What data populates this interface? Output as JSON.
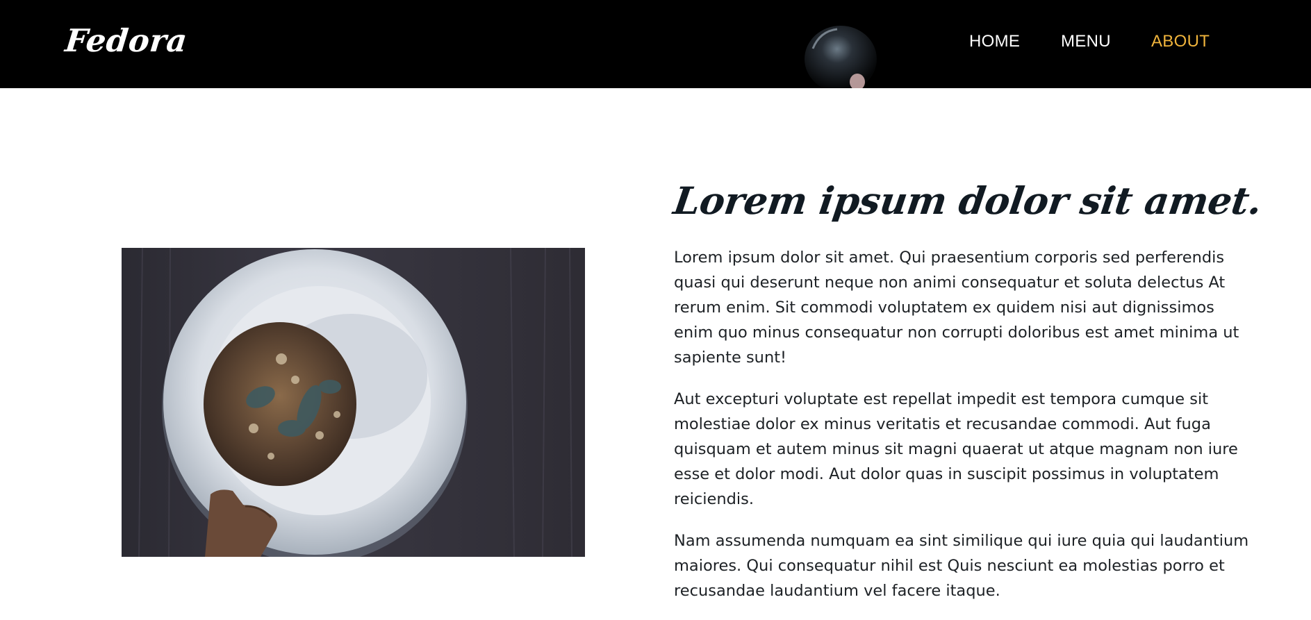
{
  "header": {
    "logo": "Fedora",
    "background_color": "#000000",
    "nav": [
      {
        "label": "HOME",
        "active": false
      },
      {
        "label": "MENU",
        "active": false
      },
      {
        "label": "ABOUT",
        "active": true
      }
    ],
    "active_color": "#f0b43c"
  },
  "about": {
    "image_icon": "food-bowl-photo",
    "headline": "Lorem ipsum dolor sit amet.",
    "paragraphs": [
      "Lorem ipsum dolor sit amet. Qui praesentium corporis sed perferendis quasi qui deserunt neque non animi consequatur et soluta delectus At rerum enim. Sit commodi voluptatem ex quidem nisi aut dignissimos enim quo minus consequatur non corrupti doloribus est amet minima ut sapiente sunt!",
      "Aut excepturi voluptate est repellat impedit est tempora cumque sit molestiae dolor ex minus veritatis et recusandae commodi. Aut fuga quisquam et autem minus sit magni quaerat ut atque magnam non iure esse et dolor modi. Aut dolor quas in suscipit possimus in voluptatem reiciendis.",
      "Nam assumenda numquam ea sint similique qui iure quia qui laudantium maiores. Qui consequatur nihil est Quis nesciunt ea molestias porro et recusandae laudantium vel facere itaque."
    ]
  }
}
